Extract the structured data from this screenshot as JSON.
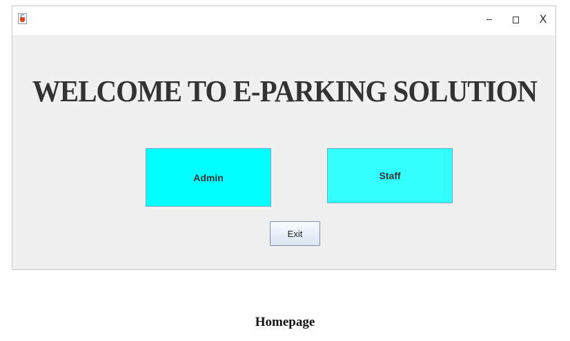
{
  "window": {
    "icon": "java-cup-icon",
    "controls": {
      "minimize": "minimize-icon",
      "maximize": "maximize-icon",
      "close_label": "X"
    }
  },
  "main": {
    "heading": "WELCOME TO E-PARKING SOLUTION",
    "admin_label": "Admin",
    "staff_label": "Staff",
    "exit_label": "Exit"
  },
  "caption": "Homepage",
  "colors": {
    "role_button_bg": "#00ffff",
    "window_bg": "#f0f0f0",
    "heading_text": "#333333"
  }
}
